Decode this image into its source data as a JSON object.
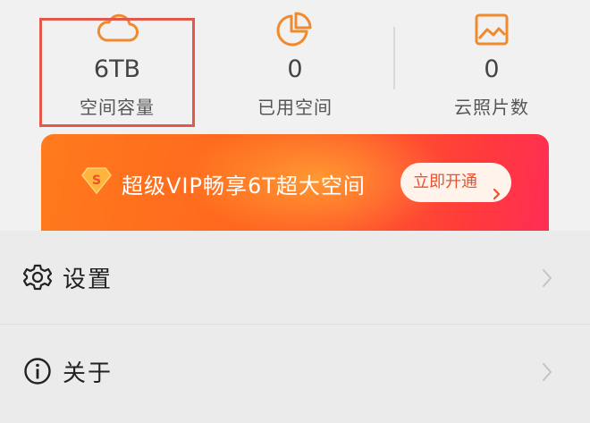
{
  "stats": [
    {
      "value": "6TB",
      "label": "空间容量",
      "icon": "cloud-icon"
    },
    {
      "value": "0",
      "label": "已用空间",
      "icon": "pie-chart-icon"
    },
    {
      "value": "0",
      "label": "云照片数",
      "icon": "image-icon"
    }
  ],
  "banner": {
    "text": "超级VIP畅享6T超大空间",
    "button_label": "立即开通",
    "badge_icon": "vip-diamond-icon",
    "badge_letter": "S"
  },
  "menu": {
    "items": [
      {
        "label": "设置",
        "icon": "gear-icon"
      },
      {
        "label": "关于",
        "icon": "info-icon"
      }
    ]
  },
  "colors": {
    "accent": "#f08a2e",
    "highlight_border": "#e2584a",
    "banner_start": "#ff7a1c",
    "banner_end": "#ff2d55",
    "button_text": "#e8532f"
  }
}
